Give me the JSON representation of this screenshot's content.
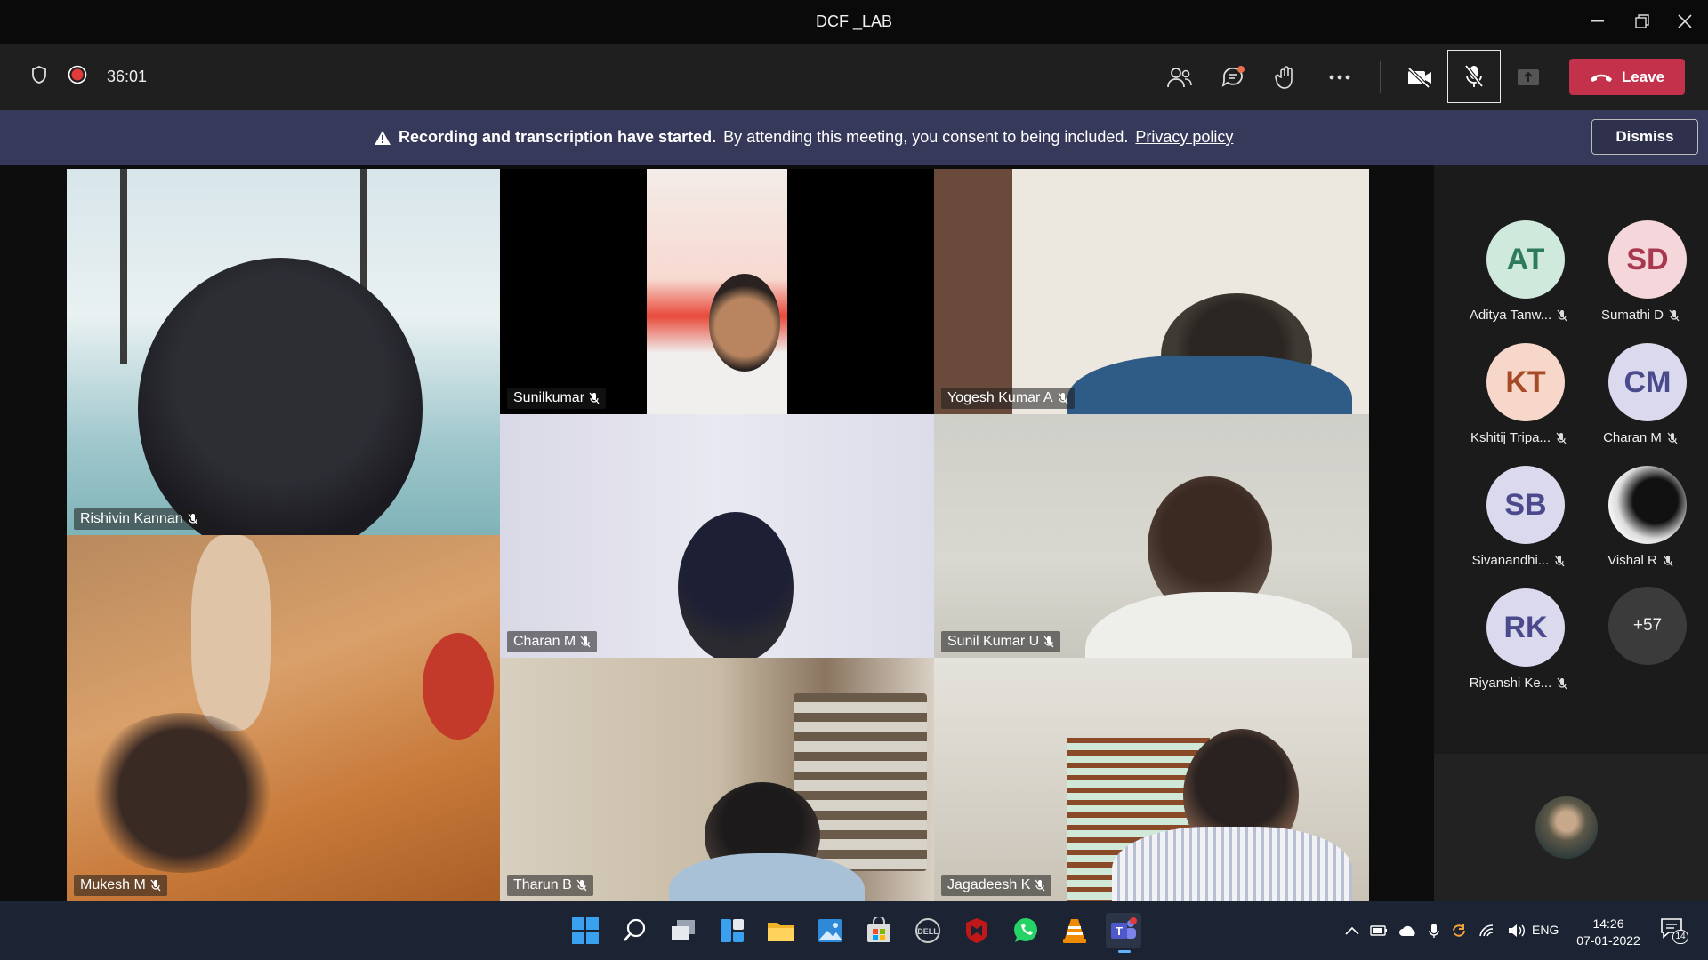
{
  "window": {
    "title": "DCF _LAB"
  },
  "toolbar": {
    "timer": "36:01",
    "leave_label": "Leave"
  },
  "banner": {
    "bold_text": "Recording and transcription have started.",
    "text": "By attending this meeting, you consent to being included.",
    "link": "Privacy policy",
    "dismiss_label": "Dismiss"
  },
  "tiles": [
    {
      "name": "Rishivin Kannan"
    },
    {
      "name": "Sunilkumar"
    },
    {
      "name": "Yogesh Kumar A"
    },
    {
      "name": "Charan M"
    },
    {
      "name": "Sunil Kumar U"
    },
    {
      "name": "Mukesh M"
    },
    {
      "name": "Tharun B"
    },
    {
      "name": "Jagadeesh K"
    }
  ],
  "participants": [
    {
      "initials": "AT",
      "name": "Aditya Tanw...",
      "color": "#cfe9dd",
      "text_color": "#2d7a5c"
    },
    {
      "initials": "SD",
      "name": "Sumathi D",
      "color": "#f4d6db",
      "text_color": "#a8384f"
    },
    {
      "initials": "KT",
      "name": "Kshitij Tripa...",
      "color": "#f7d7c9",
      "text_color": "#a74a26"
    },
    {
      "initials": "CM",
      "name": "Charan M",
      "color": "#dad9ee",
      "text_color": "#4b4a8c"
    },
    {
      "initials": "SB",
      "name": "Sivanandhi...",
      "color": "#dad9ee",
      "text_color": "#4b4a8c"
    },
    {
      "initials": "",
      "name": "Vishal R",
      "color": "#e8e8e8",
      "text_color": "#000"
    },
    {
      "initials": "RK",
      "name": "Riyanshi Ke...",
      "color": "#dad9ee",
      "text_color": "#4b4a8c"
    }
  ],
  "more_count": "+57",
  "taskbar": {
    "language": "ENG",
    "time": "14:26",
    "date": "07-01-2022",
    "notifications": "14"
  },
  "colors": {
    "leave": "#c4314b",
    "banner": "#37395a",
    "record": "#e03a3a"
  }
}
